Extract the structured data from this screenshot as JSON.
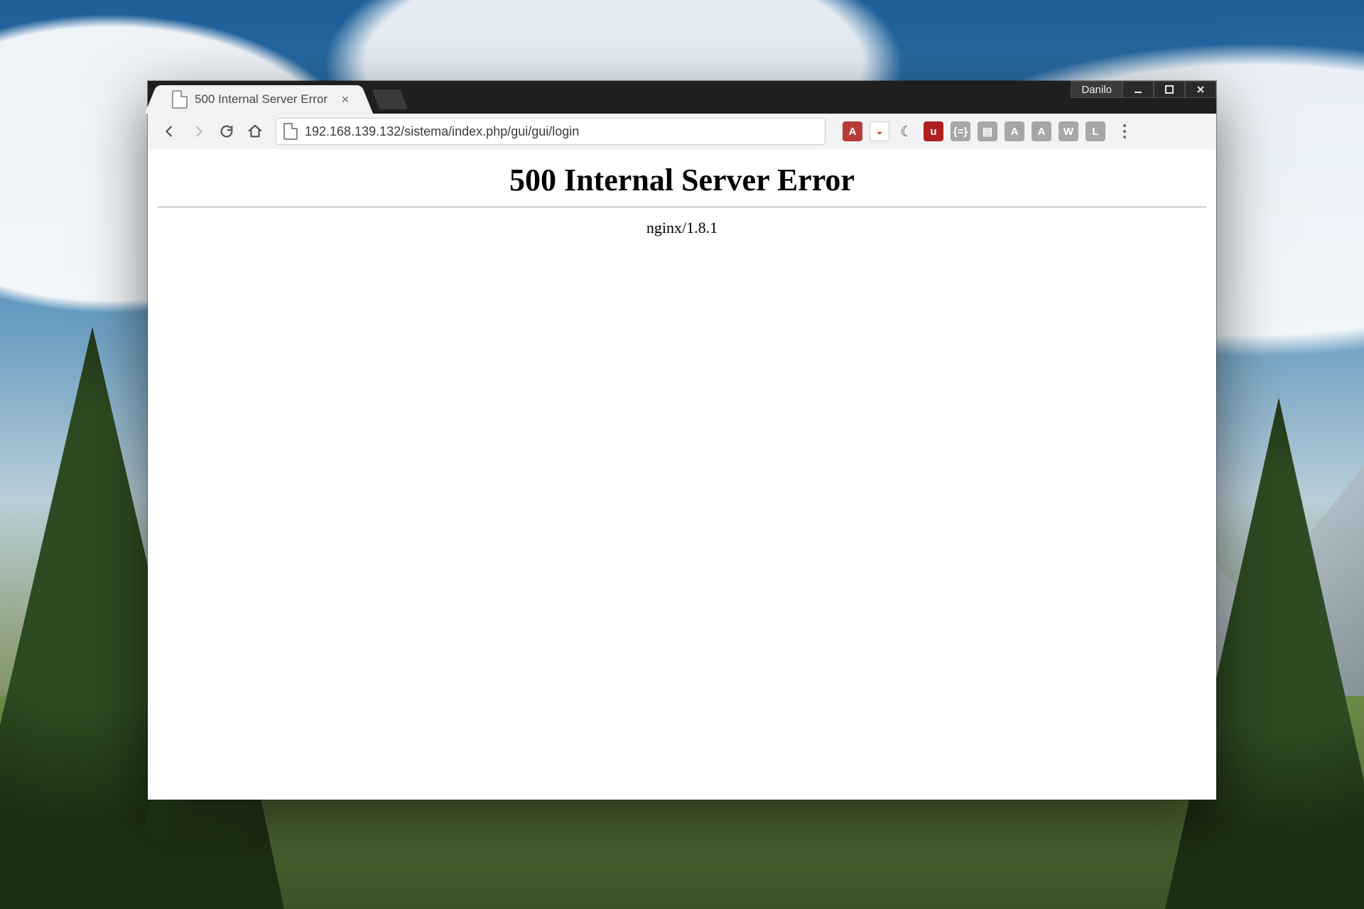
{
  "window": {
    "user_badge": "Danilo"
  },
  "tab": {
    "title": "500 Internal Server Error"
  },
  "toolbar": {
    "url": "192.168.139.132/sistema/index.php/gui/gui/login",
    "extensions": [
      {
        "name": "angular-icon",
        "label": "A",
        "bg": "#b83b3b"
      },
      {
        "name": "shield-icon",
        "label": "◒",
        "bg": "#ffffff",
        "fg": "#d24a2a",
        "border": "#cccccc"
      },
      {
        "name": "crescent-icon",
        "label": "☾",
        "bg": "transparent",
        "fg": "#444444"
      },
      {
        "name": "ublock-icon",
        "label": "u",
        "bg": "#b02020"
      },
      {
        "name": "braces-icon",
        "label": "{=}",
        "bg": "#a7a7a7"
      },
      {
        "name": "server-icon",
        "label": "▤",
        "bg": "#a7a7a7"
      },
      {
        "name": "angular2-icon",
        "label": "A",
        "bg": "#a7a7a7"
      },
      {
        "name": "letter-a-icon",
        "label": "A",
        "bg": "#a7a7a7"
      },
      {
        "name": "letter-w-icon",
        "label": "W",
        "bg": "#a7a7a7"
      },
      {
        "name": "letter-l-icon",
        "label": "L",
        "bg": "#a7a7a7"
      }
    ]
  },
  "page": {
    "heading": "500 Internal Server Error",
    "server": "nginx/1.8.1"
  }
}
